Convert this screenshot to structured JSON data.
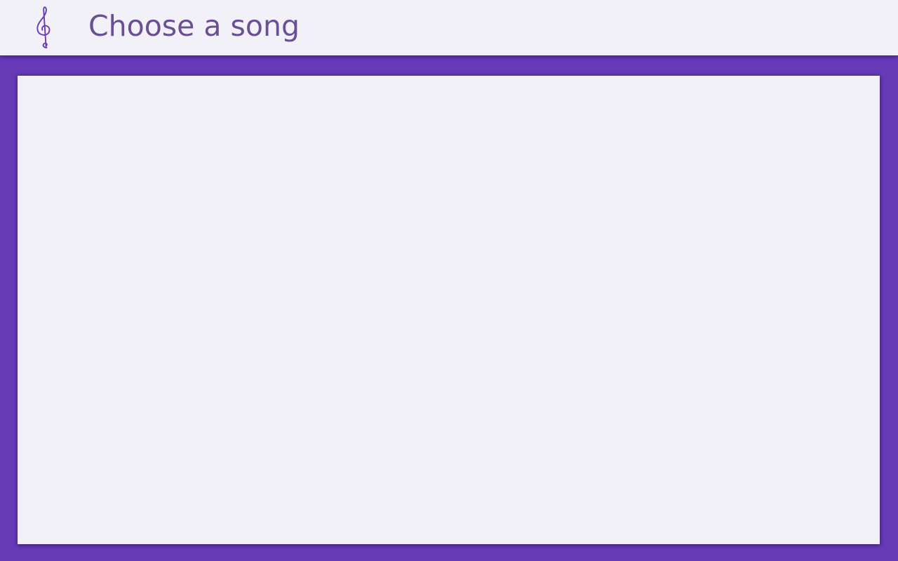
{
  "header": {
    "title": "Choose a song",
    "icon": "treble-clef-icon",
    "icon_glyph": "𝄞"
  },
  "song_list": {
    "items": []
  },
  "colors": {
    "accent": "#673ab7",
    "surface": "#f3f1f8",
    "title_text": "#6a4f94",
    "icon": "#6a3bb5"
  }
}
